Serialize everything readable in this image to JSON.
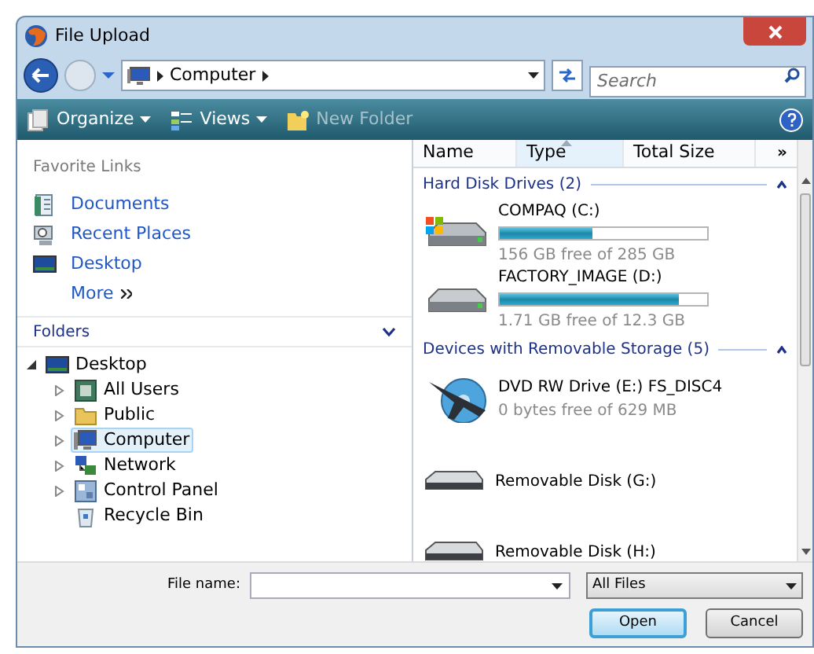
{
  "window": {
    "title": "File Upload"
  },
  "address": {
    "crumbs": [
      "Computer"
    ],
    "search_placeholder": "Search"
  },
  "toolbar": [
    {
      "label": "Organize",
      "disabled": false,
      "menu": true
    },
    {
      "label": "Views",
      "disabled": false,
      "menu": true
    },
    {
      "label": "New Folder",
      "disabled": true,
      "menu": false
    }
  ],
  "favorites": {
    "title": "Favorite Links",
    "links": [
      {
        "label": "Documents",
        "kind": "documents"
      },
      {
        "label": "Recent Places",
        "kind": "recent"
      },
      {
        "label": "Desktop",
        "kind": "desktop"
      }
    ],
    "more": "More"
  },
  "folders": {
    "title": "Folders",
    "expanded": true,
    "tree": [
      {
        "label": "Desktop",
        "kind": "desktop",
        "expanded": true,
        "selected": false,
        "children": [
          {
            "label": "All Users",
            "kind": "user",
            "expandable": true,
            "selected": false
          },
          {
            "label": "Public",
            "kind": "folder",
            "expandable": true,
            "selected": false
          },
          {
            "label": "Computer",
            "kind": "computer",
            "expandable": true,
            "selected": true
          },
          {
            "label": "Network",
            "kind": "network",
            "expandable": true,
            "selected": false
          },
          {
            "label": "Control Panel",
            "kind": "panel",
            "expandable": true,
            "selected": false
          },
          {
            "label": "Recycle Bin",
            "kind": "bin",
            "expandable": false,
            "selected": false
          }
        ]
      }
    ]
  },
  "columns": [
    {
      "label": "Name",
      "sorted": false
    },
    {
      "label": "Type",
      "sorted": true
    },
    {
      "label": "Total Size",
      "sorted": false
    }
  ],
  "columns_more": "»",
  "groups": [
    {
      "title": "Hard Disk Drives (2)",
      "expanded": true,
      "items": [
        {
          "name": "COMPAQ (C:)",
          "kind": "system-disk",
          "level": 0.45,
          "detail": "156 GB free of 285 GB"
        },
        {
          "name": "FACTORY_IMAGE (D:)",
          "kind": "disk",
          "level": 0.86,
          "detail": "1.71 GB free of 12.3 GB"
        }
      ]
    },
    {
      "title": "Devices with Removable Storage (5)",
      "expanded": true,
      "items": [
        {
          "name": "DVD RW Drive (E:) FS_DISC4",
          "kind": "dvd",
          "detail": "0 bytes free of 629 MB"
        },
        {
          "name": "Removable Disk (G:)",
          "kind": "removable"
        },
        {
          "name": "Removable Disk (H:)",
          "kind": "removable"
        }
      ]
    }
  ],
  "footer": {
    "file_name_label": "File name:",
    "filter": "All Files",
    "buttons": [
      {
        "label": "Open",
        "default": true
      },
      {
        "label": "Cancel",
        "default": false
      }
    ]
  }
}
